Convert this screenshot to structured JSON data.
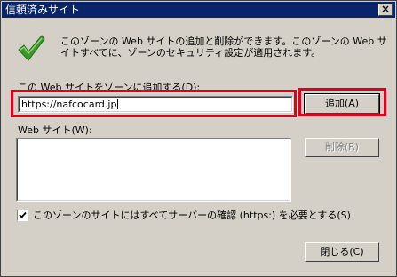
{
  "window": {
    "title": "信頼済みサイト",
    "close_glyph": "×"
  },
  "icon": "checkmark-icon",
  "description": "このゾーンの Web サイトの追加と削除ができます。このゾーンの Web サイトすべてに、ゾーンのセキュリティ設定が適用されます。",
  "add_field": {
    "label": "この Web サイトをゾーンに追加する(D):",
    "value": "https://nafcocard.jp"
  },
  "buttons": {
    "add": "追加(A)",
    "remove": "削除(R)",
    "close": "閉じる(C)"
  },
  "sites_list": {
    "label": "Web サイト(W):",
    "items": []
  },
  "https_checkbox": {
    "label": "このゾーンのサイトにはすべてサーバーの確認 (https:) を必要とする(S)",
    "checked": true
  },
  "colors": {
    "title_bar": "#0a246a",
    "dialog_bg": "#d4d0c8",
    "highlight": "#e0001c",
    "check_green": "#3a9a2a"
  }
}
